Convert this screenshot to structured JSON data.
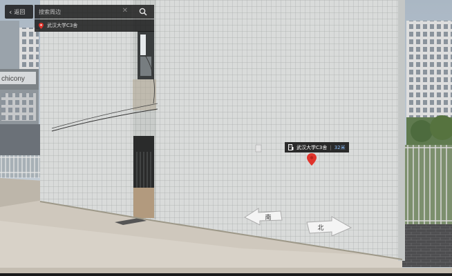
{
  "nav": {
    "back_label": "返回"
  },
  "search": {
    "placeholder": "搜索周边",
    "value": ""
  },
  "location": {
    "name": "武汉大学C3舍"
  },
  "poi": {
    "name": "武汉大学C3舍",
    "distance": "32米"
  },
  "arrows": {
    "left_label": "南",
    "right_label": "北"
  },
  "billboard": {
    "text": "chicony"
  },
  "colors": {
    "pin": "#e0332b",
    "distance": "#8fc3ff",
    "panel": "#141414"
  }
}
